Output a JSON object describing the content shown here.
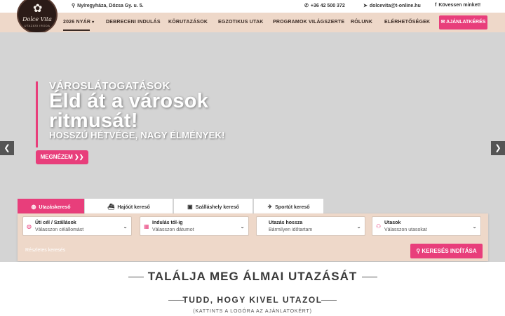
{
  "topbar": {
    "address": "Nyíregyháza, Dózsa Gy. u. 5.",
    "phone": "+36 42 500 372",
    "email": "dolcevita@t-online.hu",
    "follow": "Kövessen minket!"
  },
  "logo": {
    "name": "Dolce Vita",
    "sub": "UTAZÁSI IRODA"
  },
  "nav": {
    "items": [
      "2026 NYÁR",
      "DEBRECENI INDULÁS",
      "KÖRUTAZÁSOK",
      "EGZOTIKUS UTAK",
      "PROGRAMOK VILÁGSZERTE",
      "RÓLUNK",
      "ELÉRHETŐSÉGEK"
    ],
    "quote_button": "AJÁNLATKÉRÉS"
  },
  "hero": {
    "kicker": "VÁROSLÁTOGATÁSOK",
    "headline": "Éld át a városok ritmusát!",
    "subline": "HOSSZÚ HÉTVÉGE, NAGY ÉLMÉNYEK!",
    "cta": "MEGNÉZEM ❯❯"
  },
  "search": {
    "tabs": [
      "Utazáskereső",
      "Hajóút kereső",
      "Szálláshely kereső",
      "Sportút kereső"
    ],
    "fields": [
      {
        "label": "Úti cél / Szállások",
        "value": "Válasszon célállomást"
      },
      {
        "label": "Indulás tól-ig",
        "value": "Válasszon dátumot"
      },
      {
        "label": "Utazás hossza",
        "value": "Bármilyen időtartam"
      },
      {
        "label": "Utasok",
        "value": "Válasszon utasokat"
      }
    ],
    "detailed": "Részletes keresés",
    "button": "KERESÉS INDÍTÁSA"
  },
  "section": {
    "title": "TALÁLJA MEG ÁLMAI UTAZÁSÁT",
    "subtitle": "TUDD, HOGY KIVEL UTAZOL",
    "note": "(KATTINTS A LOGÓRA AZ AJÁNLATOKÉRT)"
  },
  "colors": {
    "accent": "#e83e7b",
    "nav_background": "#eed8c9",
    "hero_background": "#d4d4d4"
  }
}
